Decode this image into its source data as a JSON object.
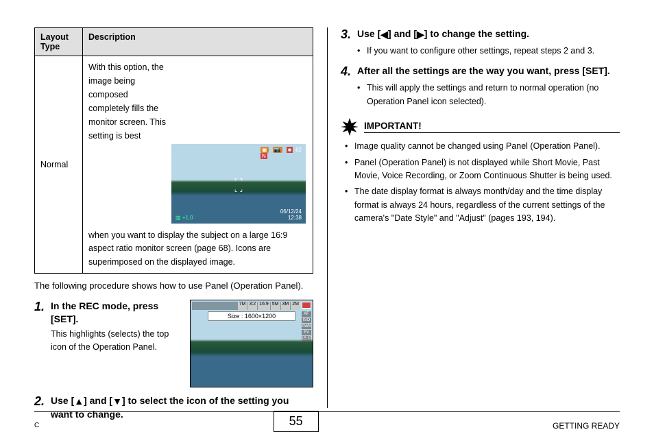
{
  "table": {
    "headers": {
      "col1": "Layout Type",
      "col2": "Description"
    },
    "row": {
      "type": "Normal",
      "desc_top": "With this option, the image being composed completely fills the monitor screen. This setting is best",
      "desc_bottom": "when you want to display the subject on a large 16:9 aspect ratio monitor screen (page 68). Icons are superimposed on the displayed image.",
      "overlay": {
        "top_num": "62",
        "date": "06/12/24",
        "time": "12:38",
        "ev": "+1.0",
        "n": "N"
      }
    }
  },
  "intro": "The following procedure shows how to use Panel (Operation Panel).",
  "steps": {
    "s1": {
      "num": "1.",
      "heading": "In the REC mode, press [SET].",
      "sub": "This highlights (selects) the top icon of the Operation Panel.",
      "img": {
        "tabs": [
          "7M",
          "3:2",
          "16:9",
          "5M",
          "3M",
          "2M"
        ],
        "size": "Size : 1600×1200",
        "side": [
          "AF",
          "ISO",
          "AWB",
          "EV",
          "15:37"
        ]
      }
    },
    "s2": {
      "num": "2.",
      "heading_pre": "Use [",
      "heading_mid": "] and [",
      "heading_post": "] to select the icon of the setting you want to change."
    },
    "s3": {
      "num": "3.",
      "heading_pre": "Use [",
      "heading_mid": "] and [",
      "heading_post": "] to change the setting.",
      "bullet": "If you want to configure other settings, repeat steps 2 and 3."
    },
    "s4": {
      "num": "4.",
      "heading": "After all the settings are the way you want, press [SET].",
      "bullet": "This will apply the settings and return to normal operation (no Operation Panel icon selected)."
    }
  },
  "important": {
    "label": "IMPORTANT!",
    "bullets": [
      "Image quality cannot be changed using Panel (Operation Panel).",
      "Panel (Operation Panel) is not displayed while Short Movie, Past Movie, Voice Recording, or Zoom Continuous Shutter is being used.",
      "The date display format is always month/day and the time display format is always 24 hours, regardless of the current settings of the camera's \"Date Style\" and \"Adjust\" (pages 193, 194)."
    ]
  },
  "footer": {
    "left": "C",
    "page": "55",
    "right": "GETTING READY"
  }
}
